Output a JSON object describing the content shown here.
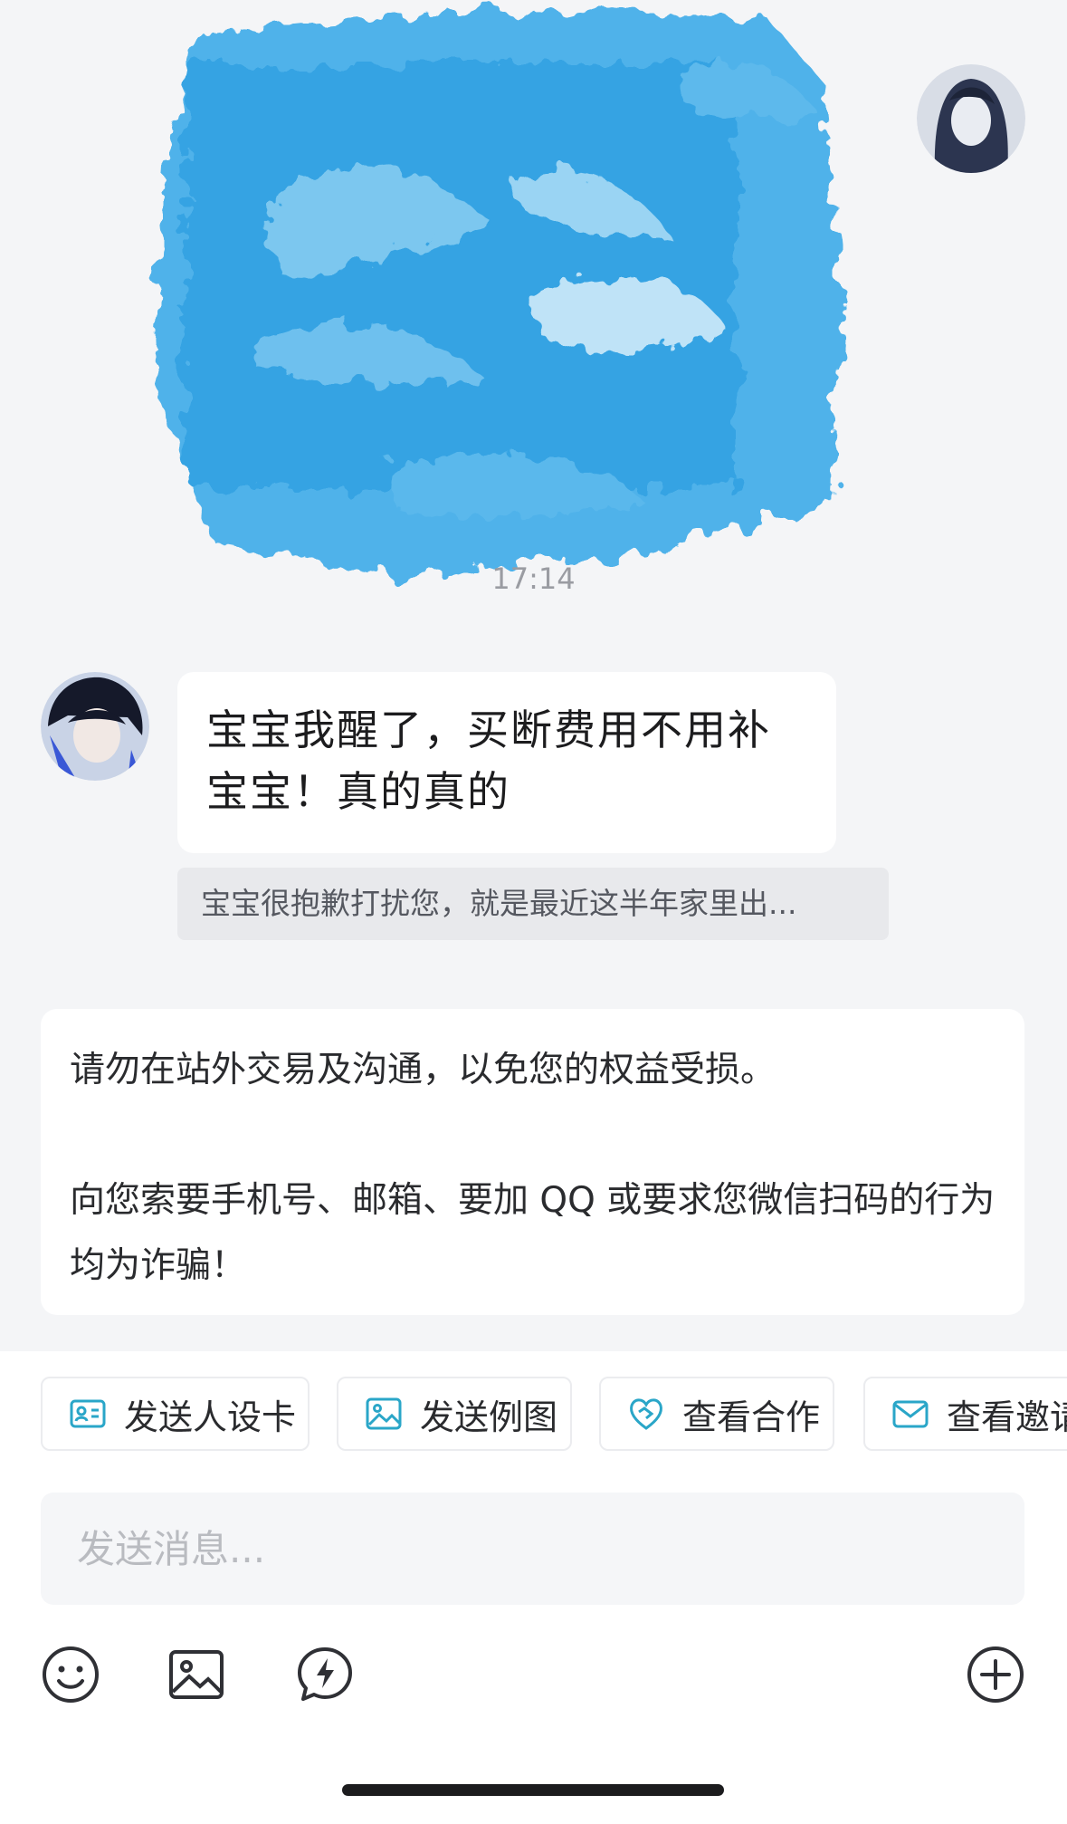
{
  "chat": {
    "timestamp": "17:14",
    "incoming_message": "宝宝我醒了，买断费用不用补宝宝！真的真的",
    "quoted_message": "宝宝很抱歉打扰您，就是最近这半年家里出...",
    "notice_line1": "请勿在站外交易及沟通，以免您的权益受损。",
    "notice_line2": "向您索要手机号、邮箱、要加 QQ 或要求您微信扫码的行为均为诈骗！"
  },
  "quick_actions": [
    {
      "label": "发送人设卡",
      "icon": "id-card-icon"
    },
    {
      "label": "发送例图",
      "icon": "image-icon"
    },
    {
      "label": "查看合作",
      "icon": "handshake-heart-icon"
    },
    {
      "label": "查看邀请",
      "icon": "envelope-icon"
    }
  ],
  "composer": {
    "placeholder": "发送消息..."
  },
  "toolbar": [
    "emoji-icon",
    "image-icon",
    "quick-reply-icon",
    "plus-circle-icon"
  ],
  "colors": {
    "background": "#f4f5f7",
    "bubble": "#ffffff",
    "accent": "#2aa6c8",
    "scribble": "#3ea7e6"
  }
}
